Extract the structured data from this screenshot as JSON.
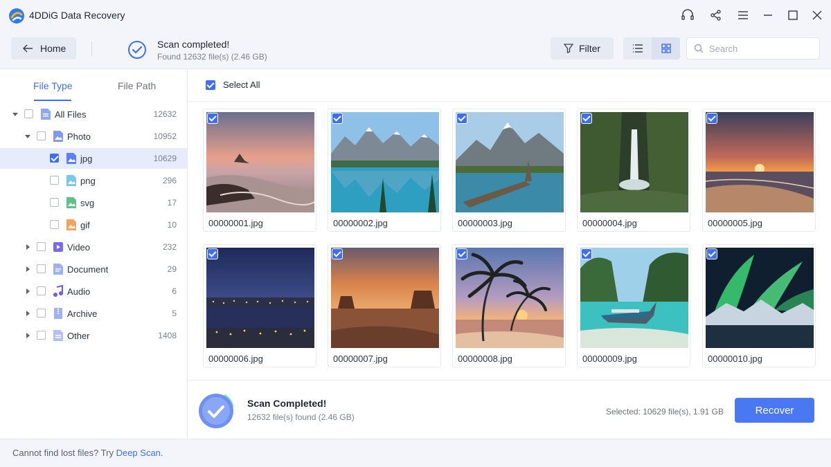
{
  "app": {
    "title": "4DDiG Data Recovery"
  },
  "toolbar": {
    "home_label": "Home",
    "scan_title": "Scan completed!",
    "scan_sub": "Found 12632 file(s) (2.46 GB)",
    "filter_label": "Filter",
    "search_placeholder": "Search"
  },
  "sidebar": {
    "tabs": [
      {
        "label": "File Type",
        "active": true
      },
      {
        "label": "File Path",
        "active": false
      }
    ],
    "tree": [
      {
        "label": "All Files",
        "count": "12632",
        "icon": "all-files-icon",
        "checked": false,
        "expanded": true
      },
      {
        "label": "Photo",
        "count": "10952",
        "icon": "photo-folder-icon",
        "checked": false,
        "expanded": true
      },
      {
        "label": "jpg",
        "count": "10629",
        "icon": "jpg-icon",
        "checked": true,
        "selected": true
      },
      {
        "label": "png",
        "count": "296",
        "icon": "png-icon",
        "checked": false
      },
      {
        "label": "svg",
        "count": "17",
        "icon": "svg-icon",
        "checked": false
      },
      {
        "label": "gif",
        "count": "10",
        "icon": "gif-icon",
        "checked": false
      },
      {
        "label": "Video",
        "count": "232",
        "icon": "video-icon",
        "checked": false,
        "expanded": false
      },
      {
        "label": "Document",
        "count": "29",
        "icon": "document-icon",
        "checked": false,
        "expanded": false
      },
      {
        "label": "Audio",
        "count": "6",
        "icon": "audio-icon",
        "checked": false,
        "expanded": false
      },
      {
        "label": "Archive",
        "count": "5",
        "icon": "archive-icon",
        "checked": false,
        "expanded": false
      },
      {
        "label": "Other",
        "count": "1408",
        "icon": "other-icon",
        "checked": false,
        "expanded": false
      }
    ]
  },
  "main": {
    "select_all_label": "Select All",
    "files": [
      {
        "name": "00000001.jpg",
        "checked": true
      },
      {
        "name": "00000002.jpg",
        "checked": true
      },
      {
        "name": "00000003.jpg",
        "checked": true
      },
      {
        "name": "00000004.jpg",
        "checked": true
      },
      {
        "name": "00000005.jpg",
        "checked": true
      },
      {
        "name": "00000006.jpg",
        "checked": true
      },
      {
        "name": "00000007.jpg",
        "checked": true
      },
      {
        "name": "00000008.jpg",
        "checked": true
      },
      {
        "name": "00000009.jpg",
        "checked": true
      },
      {
        "name": "00000010.jpg",
        "checked": true
      }
    ]
  },
  "status": {
    "title": "Scan Completed!",
    "sub": "12632 file(s) found (2.46 GB)",
    "selected": "Selected: 10629 file(s), 1.91 GB",
    "recover_label": "Recover"
  },
  "footer": {
    "prefix": "Cannot find lost files? Try ",
    "link": "Deep Scan",
    "suffix": "."
  },
  "colors": {
    "accent": "#3d6ff0",
    "button": "#4a78f2"
  }
}
